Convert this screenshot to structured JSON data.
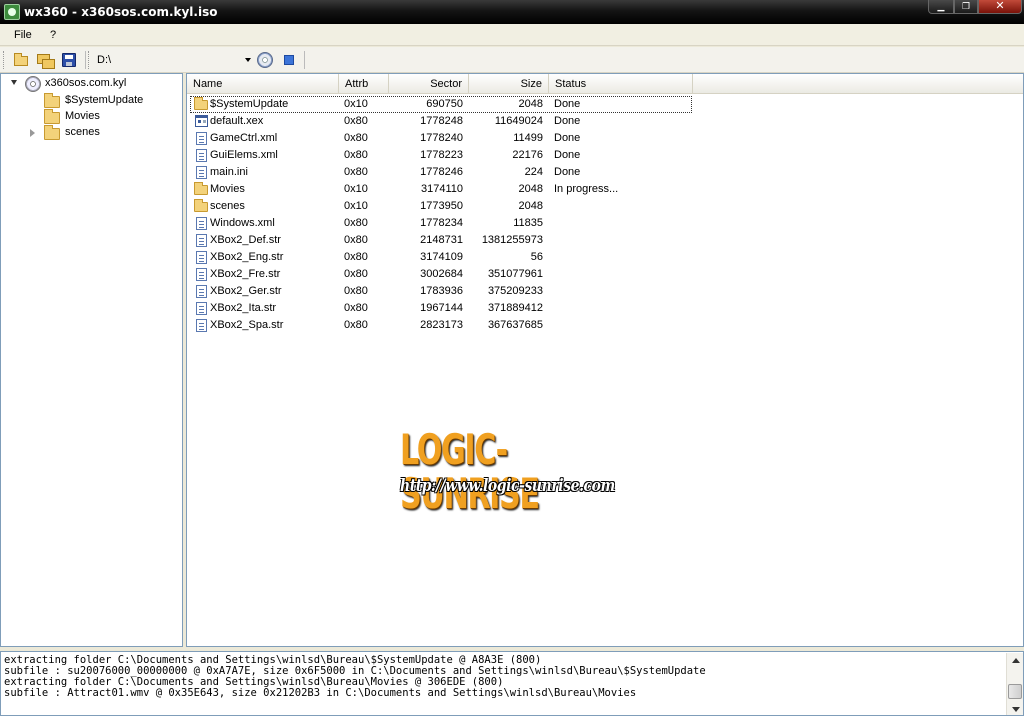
{
  "window": {
    "title": "wx360 - x360sos.com.kyl.iso",
    "minimize_icon": "minimize-icon",
    "maximize_icon": "restore-icon",
    "close_icon": "close-icon"
  },
  "menubar": {
    "items": [
      {
        "label": "File"
      },
      {
        "label": "?"
      }
    ]
  },
  "toolbar": {
    "buttons": [
      "open-folder-icon",
      "extract-folders-icon",
      "save-icon",
      "disc-icon",
      "stop-icon"
    ],
    "path_value": "D:\\"
  },
  "tree": {
    "root": {
      "label": "x360sos.com.kyl",
      "icon": "disc-icon",
      "expanded": true
    },
    "children": [
      {
        "label": "$SystemUpdate",
        "icon": "folder-icon"
      },
      {
        "label": "Movies",
        "icon": "folder-icon"
      },
      {
        "label": "scenes",
        "icon": "folder-icon",
        "has_children": true
      }
    ]
  },
  "file_list": {
    "columns": [
      "Name",
      "Attrb",
      "Sector",
      "Size",
      "Status"
    ],
    "rows": [
      {
        "icon": "folder",
        "name": "$SystemUpdate",
        "attrb": "0x10",
        "sector": "690750",
        "size": "2048",
        "status": "Done"
      },
      {
        "icon": "exe",
        "name": "default.xex",
        "attrb": "0x80",
        "sector": "1778248",
        "size": "11649024",
        "status": "Done"
      },
      {
        "icon": "file",
        "name": "GameCtrl.xml",
        "attrb": "0x80",
        "sector": "1778240",
        "size": "11499",
        "status": "Done"
      },
      {
        "icon": "file",
        "name": "GuiElems.xml",
        "attrb": "0x80",
        "sector": "1778223",
        "size": "22176",
        "status": "Done"
      },
      {
        "icon": "file",
        "name": "main.ini",
        "attrb": "0x80",
        "sector": "1778246",
        "size": "224",
        "status": "Done"
      },
      {
        "icon": "folder",
        "name": "Movies",
        "attrb": "0x10",
        "sector": "3174110",
        "size": "2048",
        "status": "In progress..."
      },
      {
        "icon": "folder",
        "name": "scenes",
        "attrb": "0x10",
        "sector": "1773950",
        "size": "2048",
        "status": ""
      },
      {
        "icon": "file",
        "name": "Windows.xml",
        "attrb": "0x80",
        "sector": "1778234",
        "size": "11835",
        "status": ""
      },
      {
        "icon": "file",
        "name": "XBox2_Def.str",
        "attrb": "0x80",
        "sector": "2148731",
        "size": "1381255973",
        "status": ""
      },
      {
        "icon": "file",
        "name": "XBox2_Eng.str",
        "attrb": "0x80",
        "sector": "3174109",
        "size": "56",
        "status": ""
      },
      {
        "icon": "file",
        "name": "XBox2_Fre.str",
        "attrb": "0x80",
        "sector": "3002684",
        "size": "351077961",
        "status": ""
      },
      {
        "icon": "file",
        "name": "XBox2_Ger.str",
        "attrb": "0x80",
        "sector": "1783936",
        "size": "375209233",
        "status": ""
      },
      {
        "icon": "file",
        "name": "XBox2_Ita.str",
        "attrb": "0x80",
        "sector": "1967144",
        "size": "371889412",
        "status": ""
      },
      {
        "icon": "file",
        "name": "XBox2_Spa.str",
        "attrb": "0x80",
        "sector": "2823173",
        "size": "367637685",
        "status": ""
      }
    ]
  },
  "watermark": {
    "title": "LOGIC-SUNRISE",
    "url": "http://www.logic-sunrise.com"
  },
  "log": {
    "lines": [
      "extracting folder C:\\Documents and Settings\\winlsd\\Bureau\\$SystemUpdate @ A8A3E (800)",
      "subfile : su20076000_00000000 @ 0xA7A7E, size 0x6F5000 in C:\\Documents and Settings\\winlsd\\Bureau\\$SystemUpdate",
      "extracting folder C:\\Documents and Settings\\winlsd\\Bureau\\Movies @ 306EDE (800)",
      "subfile : Attract01.wmv @ 0x35E643, size 0x21202B3 in C:\\Documents and Settings\\winlsd\\Bureau\\Movies"
    ]
  }
}
